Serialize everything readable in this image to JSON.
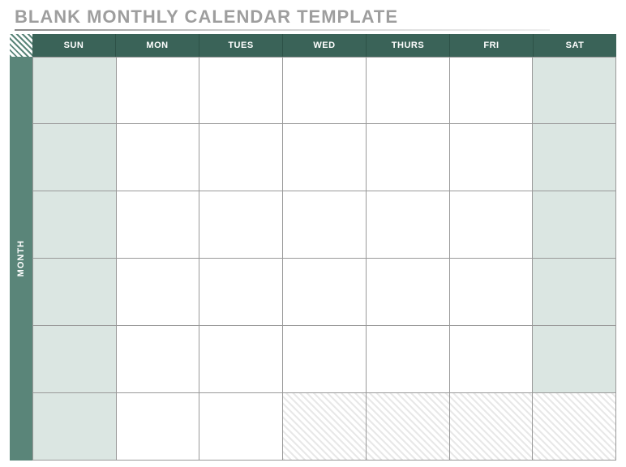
{
  "title": "BLANK MONTHLY CALENDAR TEMPLATE",
  "sidebar_label": "MONTH",
  "days": [
    "SUN",
    "MON",
    "TUES",
    "WED",
    "THURS",
    "FRI",
    "SAT"
  ],
  "colors": {
    "header_bg": "#3a6358",
    "sidebar_bg": "#5a8579",
    "shaded_cell": "#dbe6e2",
    "title_text": "#9e9e9e"
  },
  "grid": {
    "rows": 6,
    "cols": 7,
    "shaded_columns": [
      0,
      6
    ],
    "hatched_cells": [
      {
        "row": 5,
        "col": 3
      },
      {
        "row": 5,
        "col": 4
      },
      {
        "row": 5,
        "col": 5
      },
      {
        "row": 5,
        "col": 6
      }
    ]
  }
}
